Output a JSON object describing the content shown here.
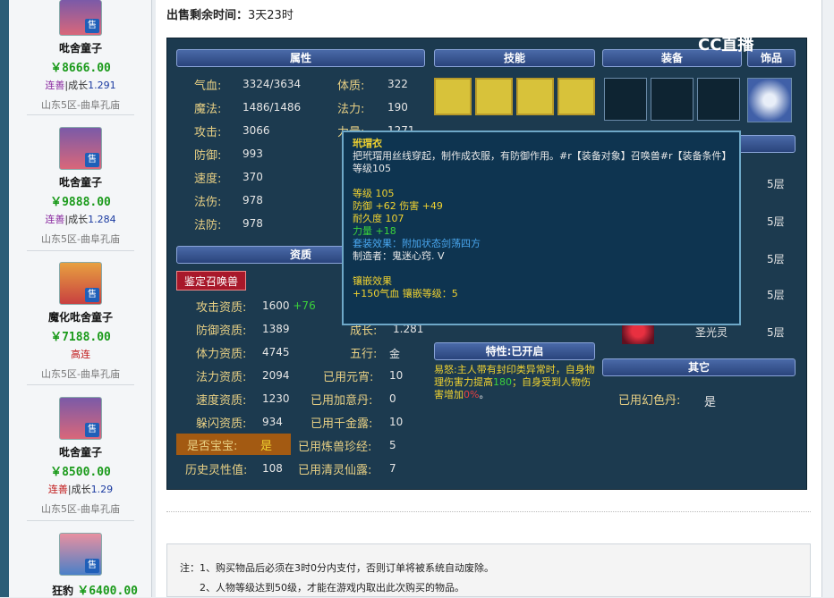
{
  "sidebar": {
    "pets": [
      {
        "name": "吡舍童子",
        "price": "￥8666.00",
        "tag1": "连善",
        "tag2": "|成长",
        "tag3": "1.291",
        "server": "山东5区-曲阜孔庙"
      },
      {
        "name": "吡舍童子",
        "price": "￥9888.00",
        "tag1": "连善",
        "tag2": "|成长",
        "tag3": "1.284",
        "server": "山东5区-曲阜孔庙"
      },
      {
        "name": "魔化吡舍童子",
        "price": "￥7188.00",
        "tag1": "高连",
        "server": "山东5区-曲阜孔庙"
      },
      {
        "name": "吡舍童子",
        "price": "￥8500.00",
        "tag1": "连善",
        "tag2": "|成长",
        "tag3": "1.29",
        "server": "山东5区-曲阜孔庙"
      },
      {
        "name": "狂豹",
        "price": "￥6400.00"
      }
    ],
    "badge": "售"
  },
  "main": {
    "remain_label": "出售剩余时间：",
    "remain_value": "3天23时"
  },
  "panel": {
    "headers": {
      "attr": "属性",
      "skill": "技能",
      "equip": "装备",
      "deco": "饰品",
      "aptitude": "资质",
      "special": "特性:已开启",
      "other": "其它"
    },
    "attrs": [
      {
        "l": "气血:",
        "v": "3324/3634"
      },
      {
        "l": "魔法:",
        "v": "1486/1486"
      },
      {
        "l": "攻击:",
        "v": "3066"
      },
      {
        "l": "防御:",
        "v": "993"
      },
      {
        "l": "速度:",
        "v": "370"
      },
      {
        "l": "法伤:",
        "v": "978"
      },
      {
        "l": "法防:",
        "v": "978"
      }
    ],
    "attrs2": [
      {
        "l": "体质:",
        "v": "322"
      },
      {
        "l": "法力:",
        "v": "190"
      },
      {
        "l": "力量:",
        "v": "1271"
      }
    ],
    "identify_btn": "鉴定召唤兽",
    "aptitudes": [
      {
        "l": "攻击资质:",
        "v": "1600",
        "p": "+76"
      },
      {
        "l": "防御资质:",
        "v": "1389"
      },
      {
        "l": "体力资质:",
        "v": "4745"
      },
      {
        "l": "法力资质:",
        "v": "2094"
      },
      {
        "l": "速度资质:",
        "v": "1230"
      },
      {
        "l": "躲闪资质:",
        "v": "934"
      }
    ],
    "baby_label": "是否宝宝:",
    "baby_value": "是",
    "history_label": "历史灵性值:",
    "history_value": "108",
    "right_col": [
      {
        "l": "成长:",
        "v": "1.281"
      },
      {
        "l": "五行:",
        "v": "金"
      },
      {
        "l": "已用元宵:",
        "v": "10"
      },
      {
        "l": "已用加意丹:",
        "v": "0"
      },
      {
        "l": "已用千金露:",
        "v": "10"
      },
      {
        "l": "已用炼兽珍经:",
        "v": "5"
      },
      {
        "l": "已用清灵仙露:",
        "v": "7"
      }
    ],
    "special_text1": "易怒:",
    "special_text2": "主人带有封印类异常时，自身物理伤害力提高",
    "special_num": "180",
    "special_text3": "；自身受到人物伤害增加",
    "special_pct": "0%",
    "special_end": "。",
    "other_label": "已用幻色丹:",
    "other_value": "是",
    "layers": [
      "5层",
      "5层",
      "5层",
      "5层",
      "5层"
    ],
    "layer_name": "圣光灵"
  },
  "tooltip": {
    "title": "玳瑁衣",
    "desc": "把玳瑁用丝线穿起，制作成衣服，有防御作用。#r【装备对象】召唤兽#r【装备条件】等级105",
    "level": "等级 105",
    "defense": "防御 +62 伤害 +49",
    "durability": "耐久度 107",
    "strength": "力量 +18",
    "set_effect": "套装效果：附加状态剑荡四方",
    "maker": "制造者：鬼迷心窍. V",
    "inlay_title": "镶嵌效果",
    "inlay": "+150气血 镶嵌等级：5"
  },
  "notes": [
    "注：1、购买物品后必须在3时0分内支付，否则订单将被系统自动废除。",
    "2、人物等级达到50级，才能在游戏内取出此次购买的物品。"
  ],
  "logo": "CC直播"
}
